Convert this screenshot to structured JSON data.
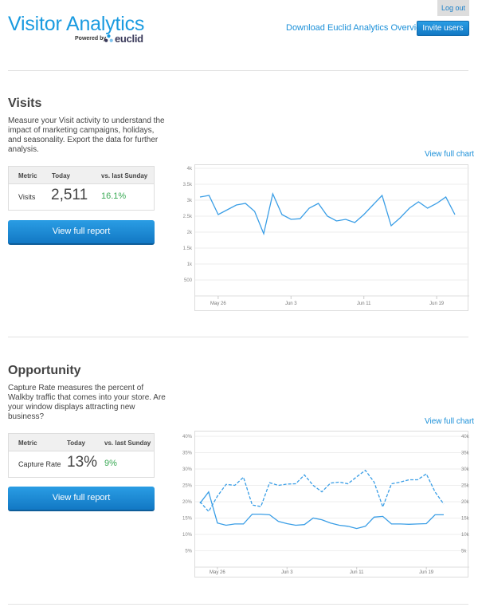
{
  "header": {
    "title": "Visitor Analytics",
    "powered_by": "Powered by",
    "brand": "euclid",
    "logout": "Log out",
    "download_link": "Download Euclid Analytics Overview",
    "invite_button": "Invite users"
  },
  "visits": {
    "title": "Visits",
    "description": "Measure your Visit activity to understand the impact of marketing campaigns, holidays, and seasonality. Export the data for further analysis.",
    "table": {
      "headers": [
        "Metric",
        "Today",
        "vs. last Sunday"
      ],
      "metric": "Visits",
      "today": "2,511",
      "change": "16.1%"
    },
    "report_button": "View full report",
    "full_chart_link": "View full chart"
  },
  "opportunity": {
    "title": "Opportunity",
    "description": "Capture Rate measures the percent of Walkby traffic that comes into your store. Are your window displays attracting new business?",
    "table": {
      "headers": [
        "Metric",
        "Today",
        "vs. last Sunday"
      ],
      "metric": "Capture Rate",
      "today": "13%",
      "change": "9%"
    },
    "report_button": "View full report",
    "full_chart_link": "View full chart"
  },
  "colors": {
    "accent": "#1a9be0",
    "line": "#3a9ee6",
    "positive": "#3aaa55"
  },
  "chart_data": [
    {
      "type": "line",
      "title": "",
      "x_ticks": [
        "May 26",
        "Jun 3",
        "Jun 11",
        "Jun 19"
      ],
      "x_tick_day_index": [
        2,
        10,
        18,
        26
      ],
      "y_ticks": [
        "500",
        "1k",
        "1.5k",
        "2k",
        "2.5k",
        "3k",
        "3.5k",
        "4k"
      ],
      "ylim": [
        0,
        4000
      ],
      "series": [
        {
          "values": [
            3100,
            3150,
            2550,
            2700,
            2850,
            2900,
            2650,
            1950,
            3200,
            2550,
            2400,
            2420,
            2750,
            2900,
            2500,
            2350,
            2400,
            2300,
            2550,
            2850,
            3150,
            2200,
            2450,
            2750,
            2950,
            2750,
            2900,
            3100,
            2550
          ]
        }
      ]
    },
    {
      "type": "line",
      "title": "",
      "x_ticks": [
        "May 26",
        "Jun 3",
        "Jun 11",
        "Jun 19"
      ],
      "x_tick_day_index": [
        2,
        10,
        18,
        26
      ],
      "y_ticks_left": [
        "5%",
        "10%",
        "15%",
        "20%",
        "25%",
        "30%",
        "35%",
        "40%"
      ],
      "y_ticks_right": [
        "5k",
        "10k",
        "15k",
        "20k",
        "25k",
        "30k",
        "35k",
        "40k"
      ],
      "ylim_left": [
        0,
        40
      ],
      "ylim_right": [
        0,
        40000
      ],
      "series": [
        {
          "axis": "left",
          "style": "solid",
          "values": [
            19.5,
            23,
            13.5,
            12.8,
            13.2,
            13.2,
            16.2,
            16.2,
            16,
            14,
            13.3,
            12.8,
            13,
            15,
            14.5,
            13.5,
            12.8,
            12.5,
            11.8,
            12.5,
            15.3,
            15.5,
            13.2,
            13.2,
            13.1,
            13.2,
            13.3,
            16,
            16
          ]
        },
        {
          "axis": "right",
          "style": "dashed",
          "values": [
            20000,
            17000,
            21700,
            25300,
            25000,
            27500,
            19000,
            18500,
            25800,
            25000,
            25400,
            25500,
            28200,
            25000,
            23000,
            25700,
            26000,
            25500,
            27600,
            29600,
            26000,
            18400,
            25500,
            26000,
            26700,
            26700,
            28500,
            23000,
            19300
          ]
        }
      ]
    }
  ]
}
